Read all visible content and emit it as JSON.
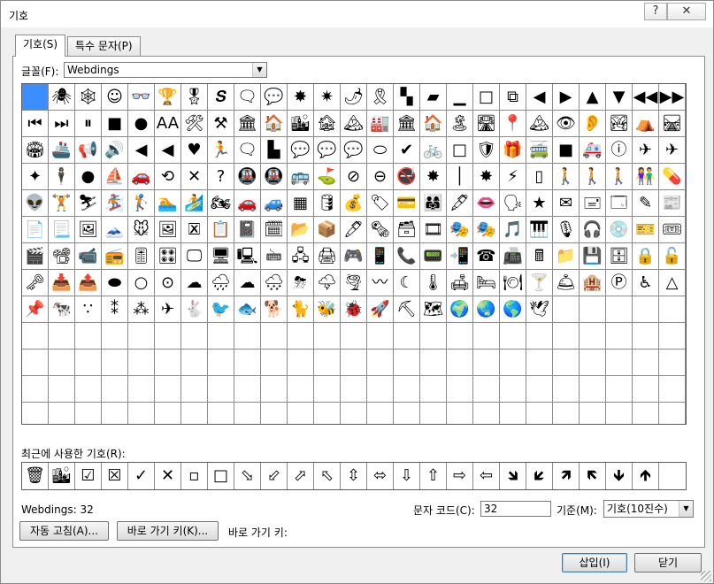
{
  "window": {
    "title": "기호",
    "help_label": "?",
    "close_label": "✕"
  },
  "tabs": [
    {
      "label": "기호(S)",
      "active": true
    },
    {
      "label": "특수 문자(P)",
      "active": false
    }
  ],
  "font": {
    "label": "글꼴(F):",
    "value": "Webdings"
  },
  "grid": {
    "columns": 25,
    "rows": 13,
    "symbols": [
      "",
      "🕷",
      "🕸",
      "☺",
      "👓",
      "🏆",
      "🎖",
      "𝑺",
      "🗨",
      "💬",
      "✸",
      "✷",
      "🌶",
      "🎗",
      "▚",
      "▰",
      "▁",
      "□",
      "⧉",
      "◀",
      "▶",
      "▲",
      "▼",
      "◀◀",
      "▶▶",
      "⏮",
      "⏭",
      "⏸",
      "■",
      "●",
      "AA",
      "🛠",
      "⚒",
      "🏛",
      "🏠",
      "🏙",
      "🏚",
      "🏔",
      "🏭",
      "🏛",
      "🏠",
      "🏝",
      "🛣",
      "📍",
      "🏔",
      "👁",
      "👂",
      "🏞",
      "⛺",
      "🛤",
      "🏟",
      "🚢",
      "📢",
      "🔊",
      "◀",
      "◀",
      "♥",
      "🏃",
      "🗨",
      "▙",
      "💬",
      "💬",
      "💬",
      "⬭",
      "✔",
      "🚲",
      "□",
      "🛡",
      "🎁",
      "🚎",
      "■",
      "🚑",
      "ⓘ",
      "✈",
      "✈",
      "✦",
      "🕴",
      "●",
      "⛵",
      "🚗",
      "⟲",
      "✕",
      "?",
      "🚇",
      "🚇",
      "🚌",
      "⛳",
      "⊘",
      "⊖",
      "🚭",
      "✸",
      "│",
      "✸",
      "⚡",
      "▯",
      "🚶",
      "🚶",
      "🚶",
      "👫",
      "💊",
      "👽",
      "🏋",
      "⛷",
      "🏂",
      "🏌",
      "🏊",
      "🏄",
      "🏍",
      "🚗",
      "🚙",
      "▦",
      "🛢",
      "💰",
      "🏷",
      "💳",
      "👨‍👩‍👧",
      "🖋",
      "👄",
      "🗣",
      "★",
      "✉",
      "🖃",
      "🗔",
      "✎",
      "📰",
      "📄",
      "📃",
      "🖼",
      "🗻",
      "🐭",
      "🖼",
      "🗷",
      "📋",
      "📓",
      "🗓",
      "📂",
      "📦",
      "🖊",
      "🗞",
      "🗃",
      "🎞",
      "🎭",
      "🎭",
      "🎵",
      "🎹",
      "🎙",
      "🎧",
      "💿",
      "🎫",
      "🎟",
      "🎬",
      "📽",
      "📹",
      "📻",
      "🎚",
      "🎛",
      "🖵",
      "🖥",
      "🖳",
      "🖮",
      "🖧",
      "🖨",
      "🎮",
      "📱",
      "📞",
      "📟",
      "📲",
      "☎",
      "📠",
      "🖩",
      "📁",
      "💾",
      "🗄",
      "🔒",
      "🔓",
      "🗝",
      "📥",
      "📤",
      "⬬",
      "○",
      "⊙",
      "☁",
      "🌧",
      "☁",
      "🌨",
      "⛈",
      "🌩",
      "🌪",
      "〰",
      "☾",
      "🌡",
      "🛋",
      "🛏",
      "🍽",
      "🍸",
      "🛎",
      "🏨",
      "Ⓟ",
      "♿",
      "△",
      "📌",
      "🐄",
      "∵",
      "⁑",
      "⁂",
      "✈",
      "🐇",
      "🐦",
      "🐟",
      "🐕",
      "🐈",
      "🐝",
      "🐞",
      "🚀",
      "⛏",
      "🗺",
      "🌍",
      "🌏",
      "🌎",
      "🕊",
      "",
      "",
      "",
      "",
      "",
      "",
      "",
      "",
      "",
      "",
      "",
      "",
      "",
      "",
      "",
      "",
      "",
      "",
      "",
      "",
      "",
      "",
      "",
      "",
      "",
      "",
      "",
      "",
      "",
      "",
      "",
      "",
      "",
      "",
      "",
      "",
      "",
      "",
      "",
      "",
      "",
      "",
      "",
      "",
      "",
      "",
      "",
      "",
      "",
      "",
      "",
      "",
      "",
      "",
      "",
      "",
      "",
      "",
      "",
      "",
      "",
      "",
      "",
      "",
      "",
      "",
      "",
      "",
      "",
      "",
      "",
      "",
      "",
      "",
      "",
      "",
      "",
      "",
      "",
      "",
      "",
      "",
      "",
      "",
      "",
      "",
      "",
      "",
      "",
      ""
    ]
  },
  "recent": {
    "label": "최근에 사용한 기호(R):",
    "symbols": [
      "🗑",
      "🏙",
      "☑",
      "☒",
      "✓",
      "✕",
      "▫",
      "□",
      "⬂",
      "⬃",
      "⬀",
      "⬁",
      "⇳",
      "⬄",
      "⇩",
      "⇧",
      "⇨",
      "⇦",
      "🡾",
      "🡿",
      "🡽",
      "🡼",
      "🡻",
      "🡹"
    ]
  },
  "status": {
    "font_code": "Webdings: 32"
  },
  "char_code": {
    "label": "문자 코드(C):",
    "value": "32"
  },
  "base": {
    "label": "기준(M):",
    "value": "기호(10진수)"
  },
  "buttons": {
    "autocorrect": "자동 고침(A)...",
    "shortcut_key": "바로 가기 키(K)...",
    "shortcut_label": "바로 가기 키:",
    "insert": "삽입(I)",
    "close": "닫기"
  }
}
